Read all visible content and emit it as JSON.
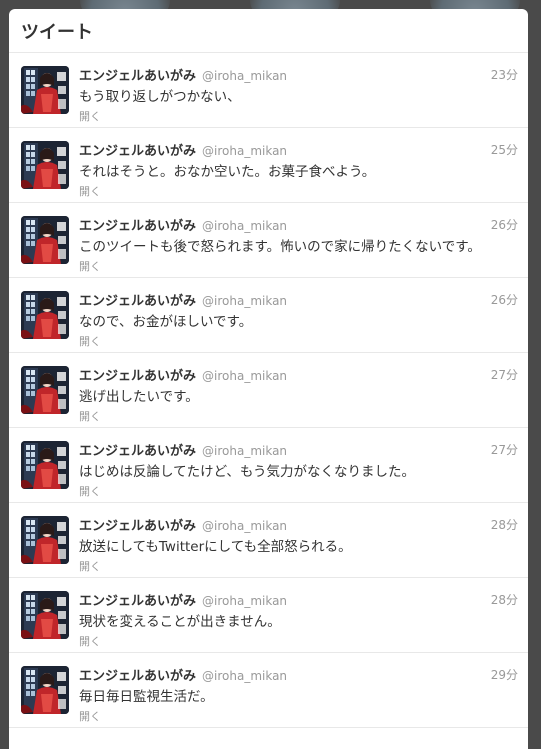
{
  "header": {
    "title": "ツイート"
  },
  "tweets": [
    {
      "name": "エンジェルあいがみ",
      "handle": "@iroha_mikan",
      "time": "23分",
      "text": "もう取り返しがつかない、",
      "action": "開く"
    },
    {
      "name": "エンジェルあいがみ",
      "handle": "@iroha_mikan",
      "time": "25分",
      "text": "それはそうと。おなか空いた。お菓子食べよう。",
      "action": "開く"
    },
    {
      "name": "エンジェルあいがみ",
      "handle": "@iroha_mikan",
      "time": "26分",
      "text": "このツイートも後で怒られます。怖いので家に帰りたくないです。",
      "action": "開く"
    },
    {
      "name": "エンジェルあいがみ",
      "handle": "@iroha_mikan",
      "time": "26分",
      "text": "なので、お金がほしいです。",
      "action": "開く"
    },
    {
      "name": "エンジェルあいがみ",
      "handle": "@iroha_mikan",
      "time": "27分",
      "text": "逃げ出したいです。",
      "action": "開く"
    },
    {
      "name": "エンジェルあいがみ",
      "handle": "@iroha_mikan",
      "time": "27分",
      "text": "はじめは反論してたけど、もう気力がなくなりました。",
      "action": "開く"
    },
    {
      "name": "エンジェルあいがみ",
      "handle": "@iroha_mikan",
      "time": "28分",
      "text": "放送にしてもTwitterにしても全部怒られる。",
      "action": "開く"
    },
    {
      "name": "エンジェルあいがみ",
      "handle": "@iroha_mikan",
      "time": "28分",
      "text": "現状を変えることが出きません。",
      "action": "開く"
    },
    {
      "name": "エンジェルあいがみ",
      "handle": "@iroha_mikan",
      "time": "29分",
      "text": "毎日毎日監視生活だ。",
      "action": "開く"
    }
  ]
}
